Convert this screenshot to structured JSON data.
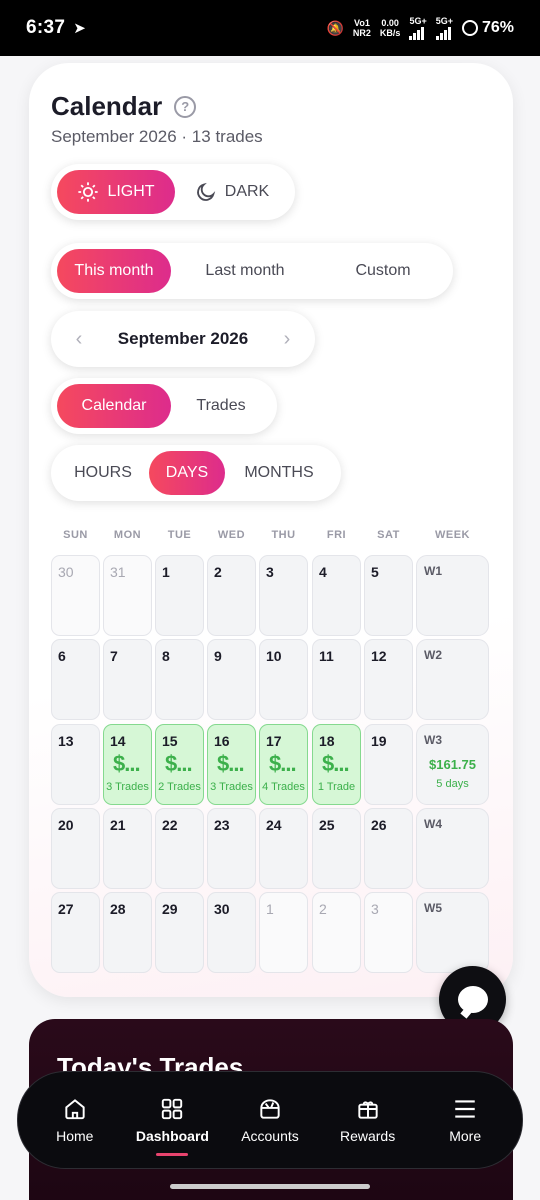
{
  "status_bar": {
    "time": "6:37",
    "net1": "Vo1",
    "net2": "NR2",
    "speed": "0.00",
    "speed_unit": "KB/s",
    "sig1": "5G+",
    "sig2": "5G+",
    "battery": "76%"
  },
  "calendar": {
    "title": "Calendar",
    "subtitle": "September 2026 · 13 trades",
    "theme_options": [
      "LIGHT",
      "DARK"
    ],
    "theme_active": "LIGHT",
    "range_options": [
      "This month",
      "Last month",
      "Custom"
    ],
    "range_active": "This month",
    "month_label": "September 2026",
    "view_options": [
      "Calendar",
      "Trades"
    ],
    "view_active": "Calendar",
    "granularity_options": [
      "HOURS",
      "DAYS",
      "MONTHS"
    ],
    "granularity_active": "DAYS",
    "weekday_headers": [
      "SUN",
      "MON",
      "TUE",
      "WED",
      "THU",
      "FRI",
      "SAT",
      "WEEK"
    ],
    "weeks": [
      {
        "label": "W1",
        "amount": "",
        "days_text": "",
        "days": [
          {
            "n": "30",
            "dim": true
          },
          {
            "n": "31",
            "dim": true
          },
          {
            "n": "1"
          },
          {
            "n": "2"
          },
          {
            "n": "3"
          },
          {
            "n": "4"
          },
          {
            "n": "5"
          }
        ]
      },
      {
        "label": "W2",
        "amount": "",
        "days_text": "",
        "days": [
          {
            "n": "6"
          },
          {
            "n": "7"
          },
          {
            "n": "8"
          },
          {
            "n": "9"
          },
          {
            "n": "10"
          },
          {
            "n": "11"
          },
          {
            "n": "12"
          }
        ]
      },
      {
        "label": "W3",
        "amount": "$161.75",
        "days_text": "5 days",
        "days": [
          {
            "n": "13"
          },
          {
            "n": "14",
            "amount": "$...",
            "trades": "3 Trades"
          },
          {
            "n": "15",
            "amount": "$...",
            "trades": "2 Trades"
          },
          {
            "n": "16",
            "amount": "$...",
            "trades": "3 Trades"
          },
          {
            "n": "17",
            "amount": "$...",
            "trades": "4 Trades"
          },
          {
            "n": "18",
            "amount": "$...",
            "trades": "1 Trade"
          },
          {
            "n": "19"
          }
        ]
      },
      {
        "label": "W4",
        "amount": "",
        "days_text": "",
        "days": [
          {
            "n": "20"
          },
          {
            "n": "21"
          },
          {
            "n": "22"
          },
          {
            "n": "23"
          },
          {
            "n": "24"
          },
          {
            "n": "25"
          },
          {
            "n": "26"
          }
        ]
      },
      {
        "label": "W5",
        "amount": "",
        "days_text": "",
        "days": [
          {
            "n": "27"
          },
          {
            "n": "28"
          },
          {
            "n": "29"
          },
          {
            "n": "30"
          },
          {
            "n": "1",
            "dim": true
          },
          {
            "n": "2",
            "dim": true
          },
          {
            "n": "3",
            "dim": true
          }
        ]
      }
    ]
  },
  "today": {
    "title": "Today's Trades"
  },
  "bottom_nav": {
    "items": [
      {
        "label": "Home",
        "icon": "home-icon"
      },
      {
        "label": "Dashboard",
        "icon": "grid-icon"
      },
      {
        "label": "Accounts",
        "icon": "wallet-icon"
      },
      {
        "label": "Rewards",
        "icon": "gift-icon"
      },
      {
        "label": "More",
        "icon": "menu-icon"
      }
    ],
    "active": "Dashboard"
  },
  "colors": {
    "accent_start": "#f5495e",
    "accent_end": "#dd2c8c",
    "profit": "#3cb04b",
    "trade_day_bg": "#d6f7d6"
  }
}
